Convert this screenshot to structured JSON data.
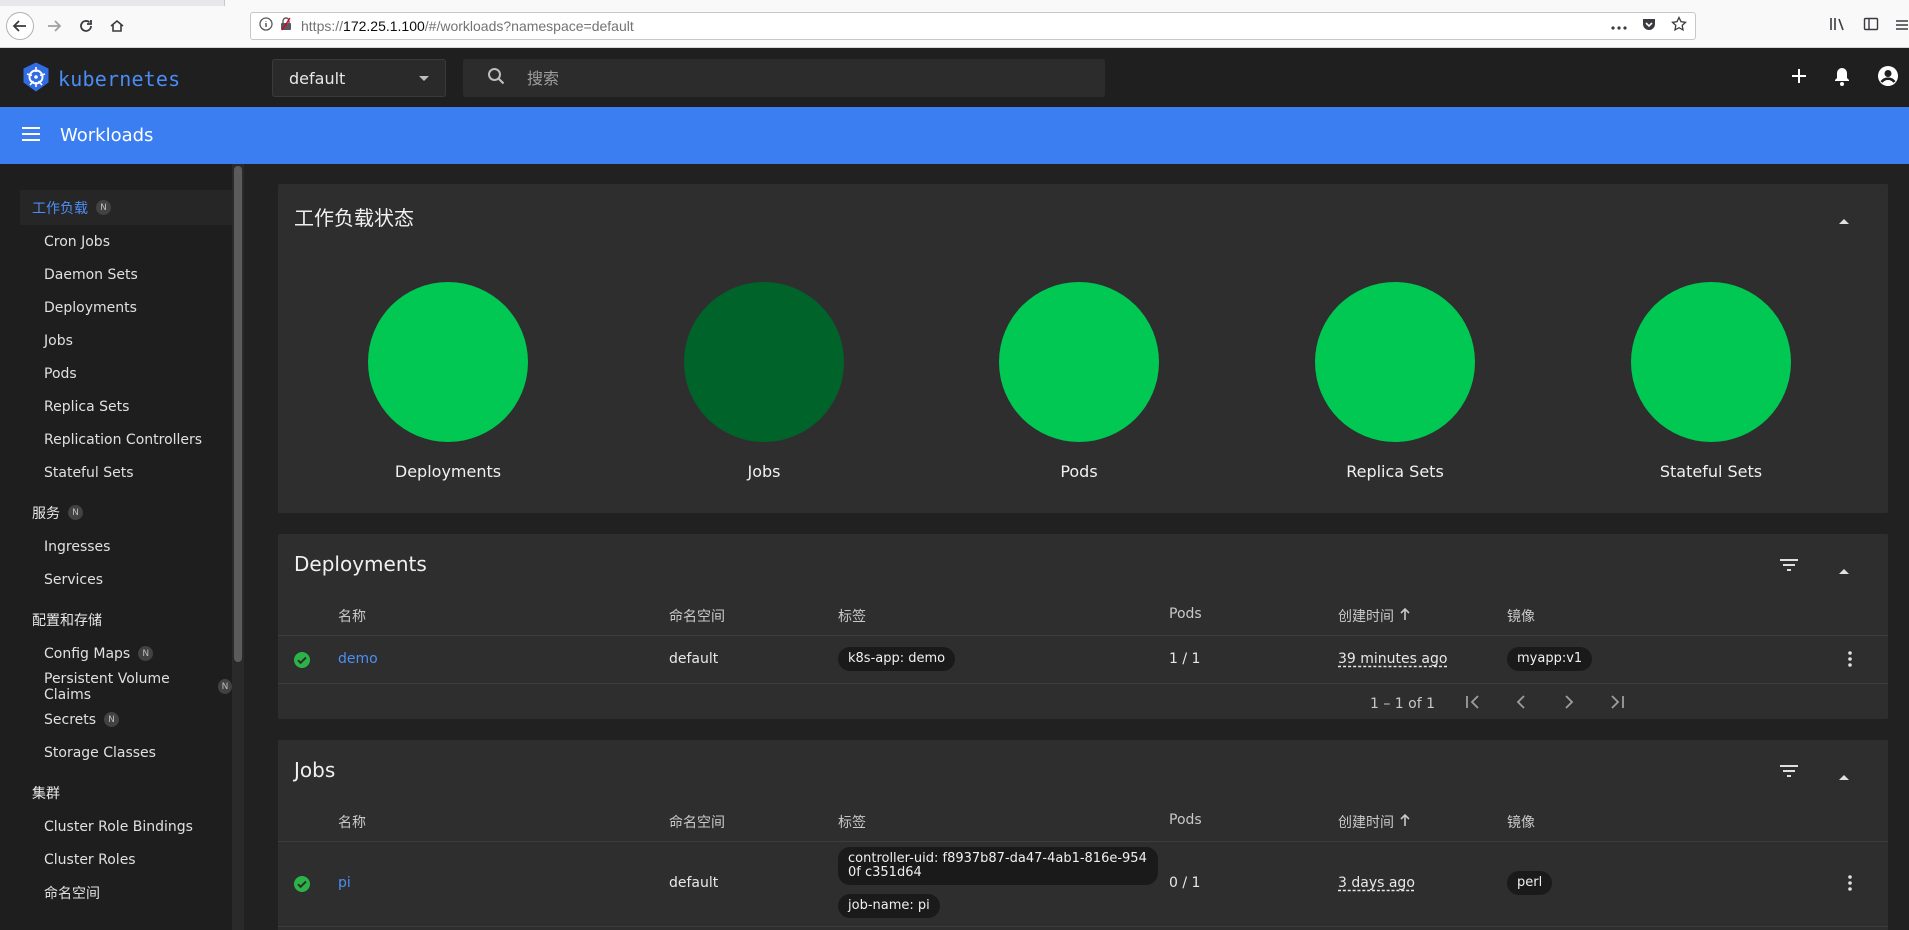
{
  "browser": {
    "url_prefix": "https://",
    "url_host": "172.25.1.100",
    "url_path": "/#/workloads?namespace=default"
  },
  "header": {
    "logo_text": "kubernetes",
    "namespace": "default",
    "search_placeholder": "搜索"
  },
  "toolbar": {
    "title": "Workloads"
  },
  "sidebar": {
    "sections": [
      {
        "label": "工作负载",
        "badge": "N",
        "items": [
          "Cron Jobs",
          "Daemon Sets",
          "Deployments",
          "Jobs",
          "Pods",
          "Replica Sets",
          "Replication Controllers",
          "Stateful Sets"
        ]
      },
      {
        "label": "服务",
        "badge": "N",
        "items": [
          "Ingresses",
          "Services"
        ]
      },
      {
        "label": "配置和存储",
        "items": [
          "Config Maps",
          "Persistent Volume Claims",
          "Secrets",
          "Storage Classes"
        ]
      },
      {
        "label": "集群",
        "items": [
          "Cluster Role Bindings",
          "Cluster Roles",
          "命名空间"
        ]
      }
    ],
    "item_badges": {
      "Config Maps": "N",
      "Persistent Volume Claims": "N",
      "Secrets": "N"
    }
  },
  "status_card": {
    "title": "工作负载状态",
    "circles": [
      {
        "label": "Deployments",
        "color": "#00c853"
      },
      {
        "label": "Jobs",
        "color": "#00632a"
      },
      {
        "label": "Pods",
        "color": "#00c853"
      },
      {
        "label": "Replica Sets",
        "color": "#00c853"
      },
      {
        "label": "Stateful Sets",
        "color": "#00c853"
      }
    ]
  },
  "columns": {
    "name": "名称",
    "namespace": "命名空间",
    "labels": "标签",
    "pods": "Pods",
    "created": "创建时间",
    "images": "镜像"
  },
  "deployments": {
    "title": "Deployments",
    "rows": [
      {
        "name": "demo",
        "namespace": "default",
        "labels": [
          "k8s-app: demo"
        ],
        "pods": "1 / 1",
        "created": "39 minutes ago",
        "image": "myapp:v1"
      }
    ],
    "pager": "1 – 1 of 1"
  },
  "jobs": {
    "title": "Jobs",
    "rows": [
      {
        "name": "pi",
        "namespace": "default",
        "labels": [
          "controller-uid: f8937b87-da47-4ab1-816e-9540f c351d64",
          "job-name: pi"
        ],
        "pods": "0 / 1",
        "created": "3 days ago",
        "image": "perl"
      }
    ]
  },
  "colors": {
    "accent": "#3a7ef2",
    "link": "#4d8df6",
    "success": "#2bb34a"
  }
}
